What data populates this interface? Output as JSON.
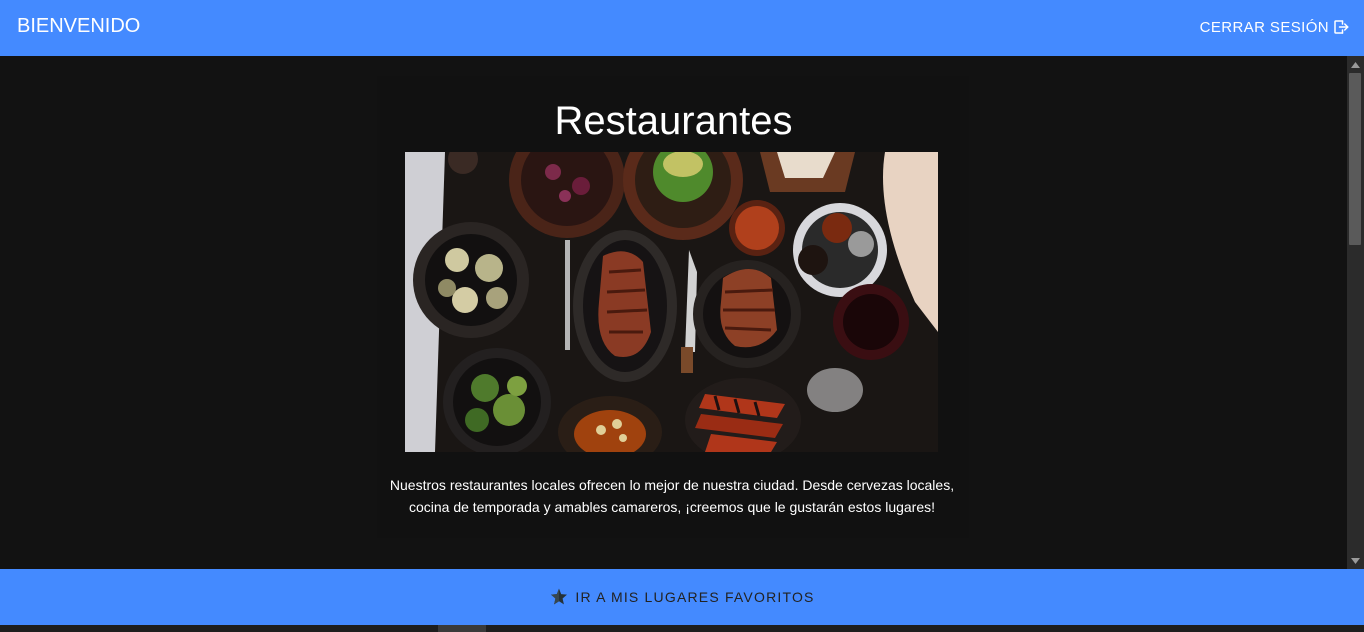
{
  "header": {
    "title": "BIENVENIDO",
    "logout_label": "CERRAR SESIÓN",
    "logout_icon": "logout-icon",
    "background": "#448aff"
  },
  "main": {
    "heading": "Restaurantes",
    "image_icon": "restaurant-food-photo",
    "description": "Nuestros restaurantes locales ofrecen lo mejor de nuestra ciudad. Desde cervezas locales, cocina de temporada y amables camareros, ¡creemos que le gustarán estos lugares!"
  },
  "footer": {
    "favorites_label": "IR A MIS LUGARES FAVORITOS",
    "favorites_icon": "star-icon",
    "background": "#448aff"
  },
  "colors": {
    "accent": "#448aff",
    "page_background": "#121212",
    "text": "#ffffff"
  }
}
